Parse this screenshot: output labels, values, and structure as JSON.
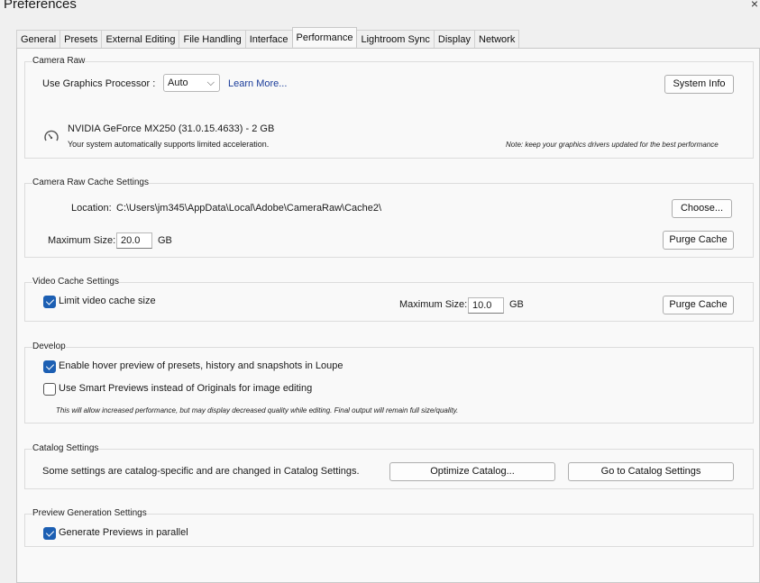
{
  "window": {
    "title": "Preferences",
    "close_glyph": "×"
  },
  "tabs": [
    {
      "label": "General"
    },
    {
      "label": "Presets"
    },
    {
      "label": "External Editing"
    },
    {
      "label": "File Handling"
    },
    {
      "label": "Interface"
    },
    {
      "label": "Performance"
    },
    {
      "label": "Lightroom Sync"
    },
    {
      "label": "Display"
    },
    {
      "label": "Network"
    }
  ],
  "active_tab": "Performance",
  "camera_raw": {
    "title": "Camera Raw",
    "gpu_label": "Use Graphics Processor :",
    "gpu_value": "Auto",
    "learn_more": "Learn More...",
    "system_info": "System Info",
    "gpu_name": "NVIDIA GeForce MX250 (31.0.15.4633) - 2 GB",
    "gpu_status": "Your system automatically supports limited acceleration.",
    "driver_note": "Note: keep your graphics drivers updated for the best performance",
    "gauge_icon": "gauge-icon"
  },
  "raw_cache": {
    "title": "Camera Raw Cache Settings",
    "location_label": "Location:",
    "location_value": "C:\\Users\\jm345\\AppData\\Local\\Adobe\\CameraRaw\\Cache2\\",
    "choose": "Choose...",
    "max_label": "Maximum Size:",
    "max_value": "20.0",
    "unit": "GB",
    "purge": "Purge Cache"
  },
  "video_cache": {
    "title": "Video Cache Settings",
    "limit_label": "Limit video cache size",
    "limit_checked": true,
    "max_label": "Maximum Size:",
    "max_value": "10.0",
    "unit": "GB",
    "purge": "Purge Cache"
  },
  "develop": {
    "title": "Develop",
    "hover_label": "Enable hover preview of presets, history and snapshots in Loupe",
    "hover_checked": true,
    "smart_label": "Use Smart Previews instead of Originals for image editing",
    "smart_checked": false,
    "smart_note": "This will allow increased performance, but may display decreased quality while editing. Final output will remain full size/quality."
  },
  "catalog": {
    "title": "Catalog Settings",
    "text": "Some settings are catalog-specific and are changed in Catalog Settings.",
    "optimize": "Optimize Catalog...",
    "goto": "Go to Catalog Settings"
  },
  "preview_gen": {
    "title": "Preview Generation Settings",
    "parallel_label": "Generate Previews in parallel",
    "parallel_checked": true
  },
  "colors": {
    "accent": "#1c5fb3",
    "link": "#1a3c9a",
    "panel": "#f9f9f9"
  }
}
